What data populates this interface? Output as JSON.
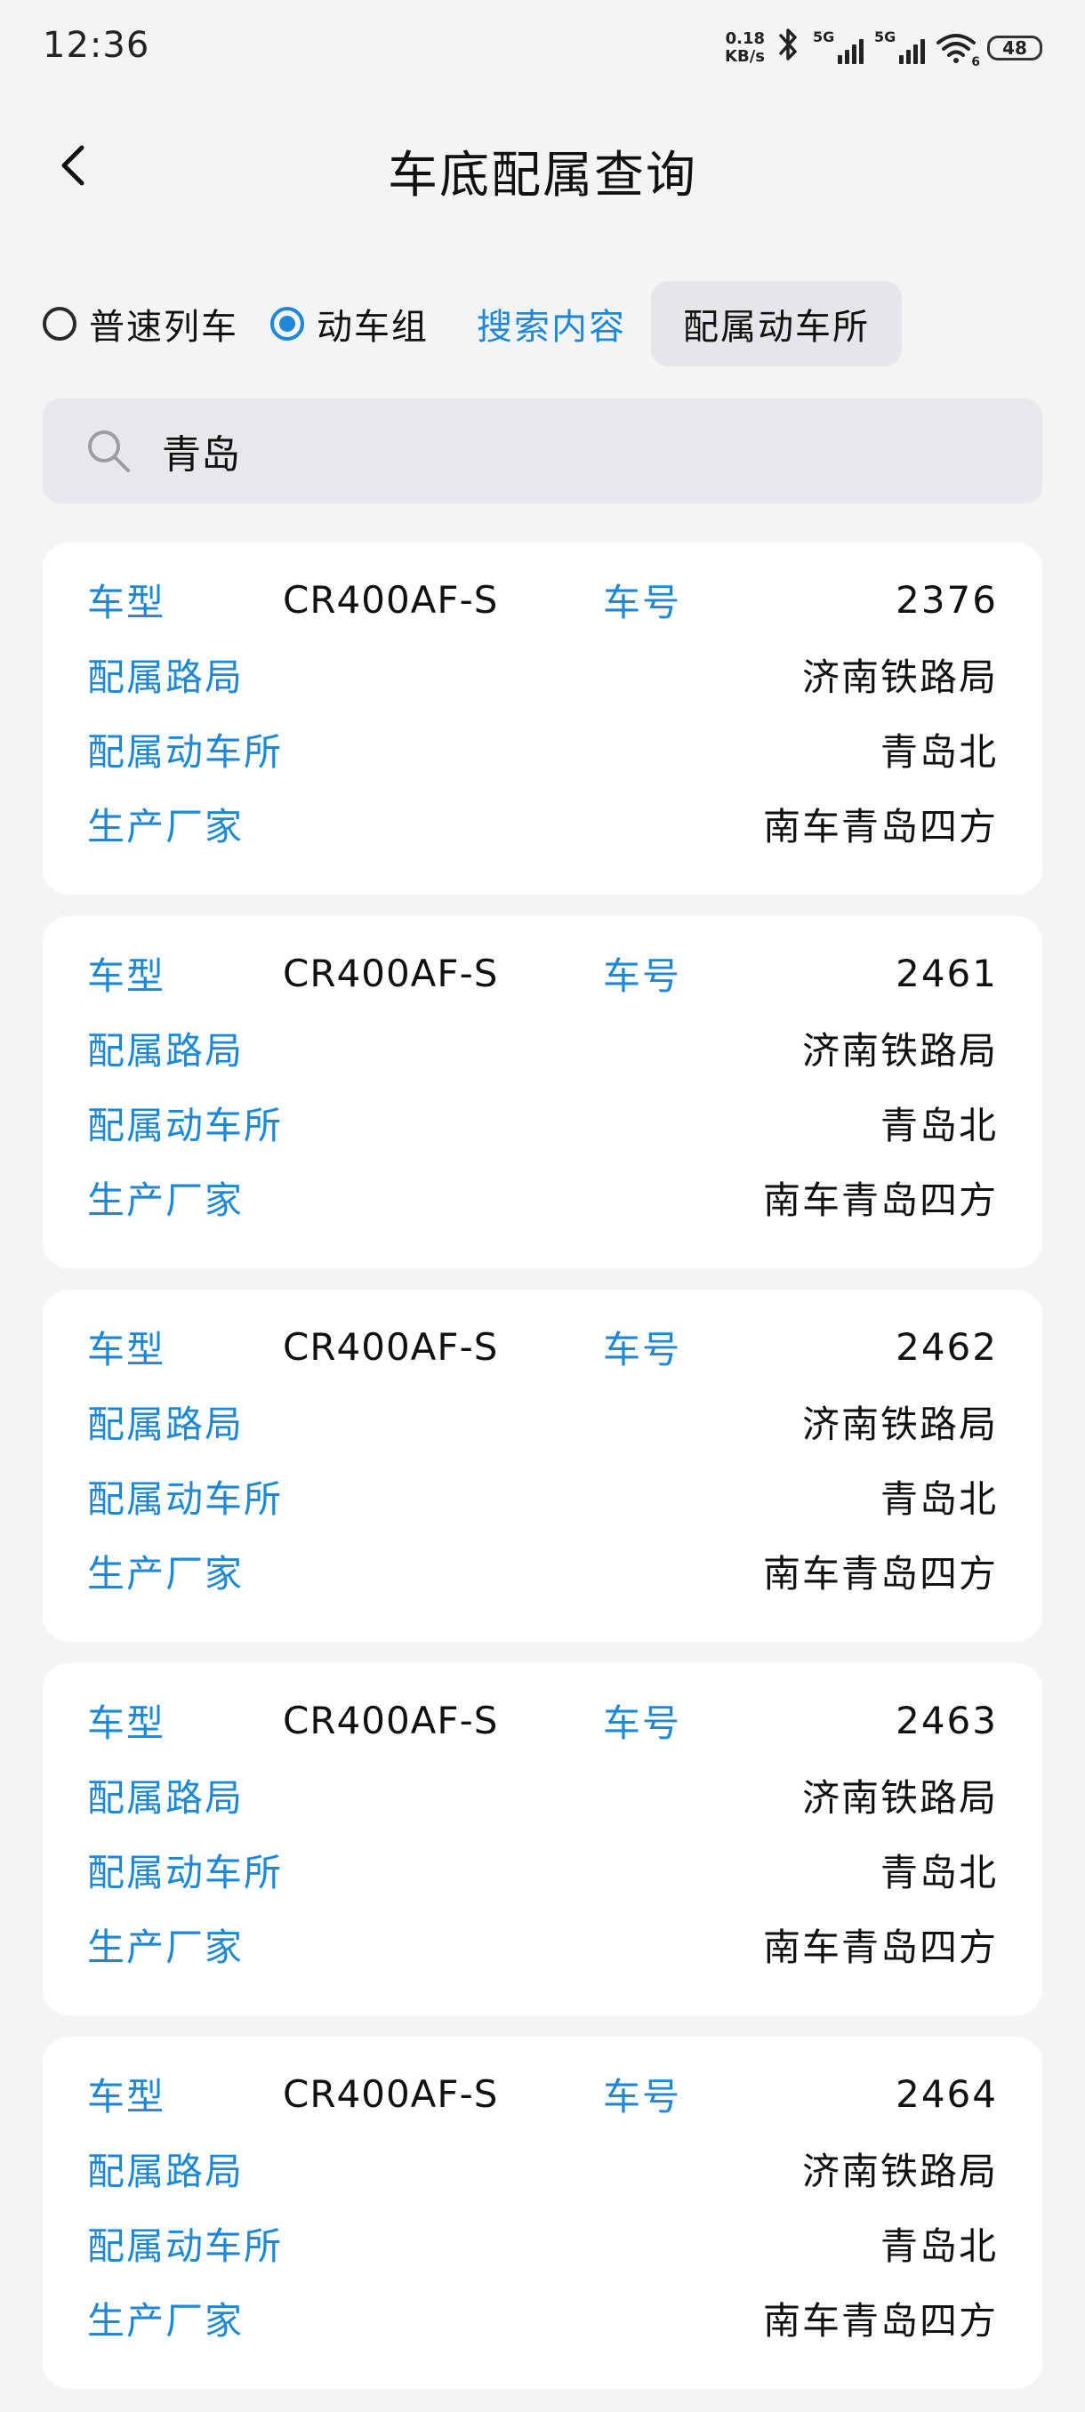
{
  "status_bar": {
    "time": "12:36",
    "net_speed_value": "0.18",
    "net_speed_unit": "KB/s",
    "sim1_tag": "5G",
    "sim2_tag": "5G",
    "wifi_badge": "6",
    "battery": "48"
  },
  "header": {
    "title": "车底配属查询"
  },
  "filters": {
    "train_type_options": [
      {
        "label": "普速列车",
        "checked": false
      },
      {
        "label": "动车组",
        "checked": true
      }
    ],
    "scope_label": "搜索内容",
    "scope_value": "配属动车所"
  },
  "search": {
    "value": "青岛"
  },
  "results": [
    {
      "model_label": "车型",
      "model": "CR400AF-S",
      "number_label": "车号",
      "number": "2376",
      "bureau_label": "配属路局",
      "bureau": "济南铁路局",
      "depot_label": "配属动车所",
      "depot": "青岛北",
      "maker_label": "生产厂家",
      "maker": "南车青岛四方"
    },
    {
      "model_label": "车型",
      "model": "CR400AF-S",
      "number_label": "车号",
      "number": "2461",
      "bureau_label": "配属路局",
      "bureau": "济南铁路局",
      "depot_label": "配属动车所",
      "depot": "青岛北",
      "maker_label": "生产厂家",
      "maker": "南车青岛四方"
    },
    {
      "model_label": "车型",
      "model": "CR400AF-S",
      "number_label": "车号",
      "number": "2462",
      "bureau_label": "配属路局",
      "bureau": "济南铁路局",
      "depot_label": "配属动车所",
      "depot": "青岛北",
      "maker_label": "生产厂家",
      "maker": "南车青岛四方"
    },
    {
      "model_label": "车型",
      "model": "CR400AF-S",
      "number_label": "车号",
      "number": "2463",
      "bureau_label": "配属路局",
      "bureau": "济南铁路局",
      "depot_label": "配属动车所",
      "depot": "青岛北",
      "maker_label": "生产厂家",
      "maker": "南车青岛四方"
    },
    {
      "model_label": "车型",
      "model": "CR400AF-S",
      "number_label": "车号",
      "number": "2464",
      "bureau_label": "配属路局",
      "bureau": "济南铁路局",
      "depot_label": "配属动车所",
      "depot": "青岛北",
      "maker_label": "生产厂家",
      "maker": "南车青岛四方"
    }
  ],
  "colors": {
    "accent": "#1e88d6",
    "background": "#f3f4f6",
    "card": "#ffffff",
    "chip": "#e4e6ea"
  },
  "icons": {
    "back": "chevron-left-icon",
    "search": "search-icon",
    "bluetooth": "bluetooth-icon",
    "wifi": "wifi-icon",
    "battery": "battery-icon",
    "signal": "signal-icon"
  }
}
